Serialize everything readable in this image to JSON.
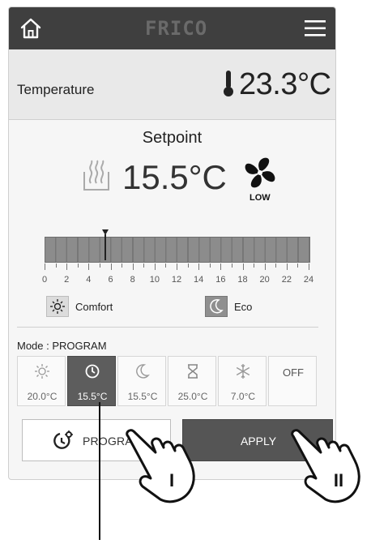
{
  "header": {
    "home_icon": "home-icon",
    "logo_text": "FRICO",
    "menu_icon": "hamburger-menu-icon"
  },
  "temperature": {
    "label": "Temperature",
    "value": "23.3°C",
    "icon": "thermometer-icon"
  },
  "setpoint": {
    "title": "Setpoint",
    "value": "15.5°C",
    "heat_icon": "heat-waves-icon",
    "fan_icon": "fan-icon",
    "fan_speed": "LOW"
  },
  "timeline": {
    "ticks": [
      "0",
      "2",
      "4",
      "6",
      "8",
      "10",
      "12",
      "14",
      "16",
      "18",
      "20",
      "22",
      "24"
    ],
    "marker_hour": 5.5
  },
  "legend": {
    "comfort": "Comfort",
    "eco": "Eco"
  },
  "mode": {
    "label": "Mode : PROGRAM",
    "options": [
      {
        "icon": "sun-icon",
        "temp": "20.0°C"
      },
      {
        "icon": "clock-icon",
        "temp": "15.5°C",
        "active": true
      },
      {
        "icon": "moon-icon",
        "temp": "15.5°C"
      },
      {
        "icon": "hourglass-icon",
        "temp": "25.0°C"
      },
      {
        "icon": "snowflake-icon",
        "temp": "7.0°C"
      },
      {
        "icon": "",
        "temp": "",
        "text": "OFF"
      }
    ]
  },
  "buttons": {
    "program": "PROGRAM",
    "apply": "APPLY"
  },
  "annotations": {
    "hand_left": "I",
    "hand_right": "II"
  },
  "colors": {
    "topbar": "#3f3f3f",
    "active_mode": "#5d5d5d",
    "apply": "#555555"
  }
}
